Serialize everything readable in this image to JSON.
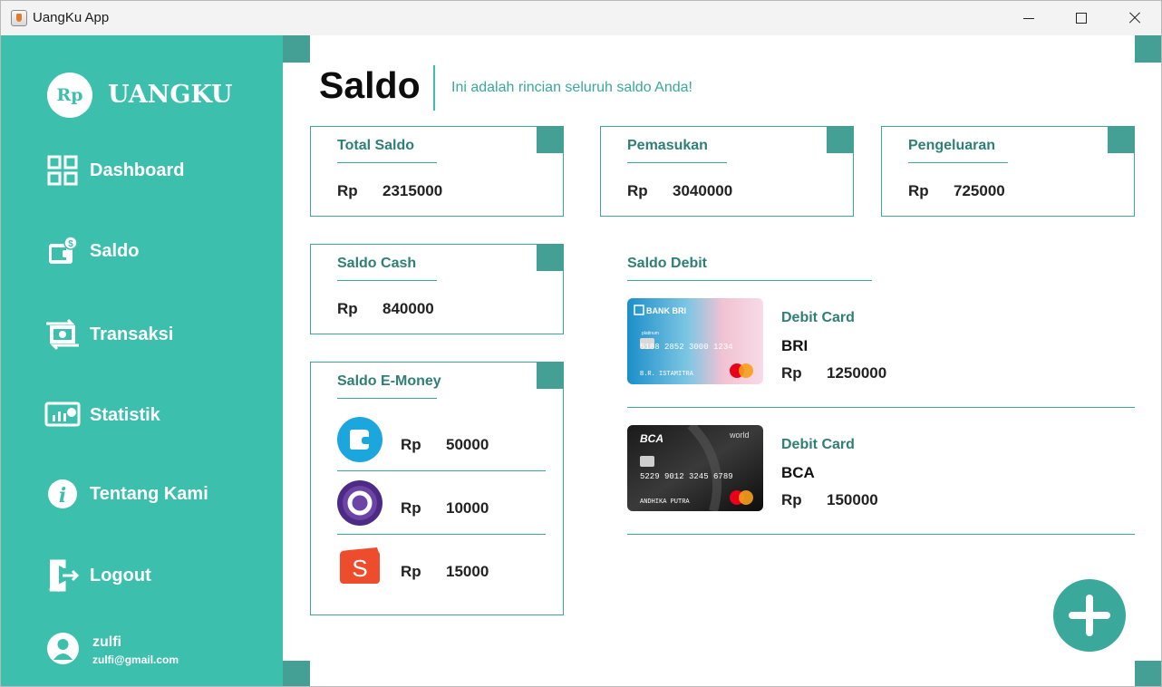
{
  "window": {
    "title": "UangKu App"
  },
  "sidebar": {
    "logo_mark": "Rp",
    "logo_text": "UANGKU",
    "items": [
      {
        "label": "Dashboard",
        "icon": "dashboard-grid-icon"
      },
      {
        "label": "Saldo",
        "icon": "wallet-icon"
      },
      {
        "label": "Transaksi",
        "icon": "transfer-icon"
      },
      {
        "label": "Statistik",
        "icon": "statistics-icon"
      },
      {
        "label": "Tentang Kami",
        "icon": "info-icon"
      },
      {
        "label": "Logout",
        "icon": "logout-door-icon"
      }
    ],
    "user": {
      "name": "zulfi",
      "email": "zulfi@gmail.com"
    }
  },
  "header": {
    "title": "Saldo",
    "subtitle": "Ini adalah rincian seluruh saldo Anda!"
  },
  "summary": {
    "currency": "Rp",
    "total": {
      "title": "Total Saldo",
      "amount": "2315000"
    },
    "income": {
      "title": "Pemasukan",
      "amount": "3040000"
    },
    "expense": {
      "title": "Pengeluaran",
      "amount": "725000"
    },
    "cash": {
      "title": "Saldo Cash",
      "amount": "840000"
    }
  },
  "emoney": {
    "title": "Saldo E-Money",
    "items": [
      {
        "icon": "dana-wallet-icon",
        "amount": "50000"
      },
      {
        "icon": "ovo-icon",
        "amount": "10000"
      },
      {
        "icon": "shopeepay-icon",
        "amount": "15000"
      }
    ]
  },
  "debit": {
    "title": "Saldo Debit",
    "cards": [
      {
        "label": "Debit Card",
        "bank": "BRI",
        "amount": "1250000",
        "image": {
          "brand": "BANK BRI",
          "number": "5188 2852 3000 1234",
          "holder": "B.R. ISTAMITRA"
        }
      },
      {
        "label": "Debit Card",
        "bank": "BCA",
        "amount": "150000",
        "image": {
          "brand": "BCA",
          "tier": "world",
          "number": "5229 9012 3245 6789",
          "holder": "ANDHIKA PUTRA"
        }
      }
    ]
  },
  "colors": {
    "accent": "#3dbfae",
    "accent_dark": "#44a094",
    "title_text": "#2f7f76"
  }
}
